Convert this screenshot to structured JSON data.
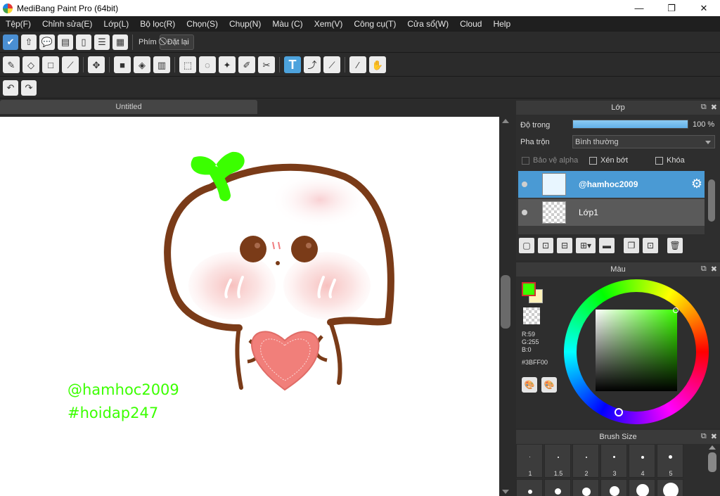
{
  "window": {
    "title": "MediBang Paint Pro (64bit)",
    "minimize_glyph": "—",
    "maximize_glyph": "❐",
    "close_glyph": "✕"
  },
  "menu": [
    "Tệp(F)",
    "Chỉnh sửa(E)",
    "Lớp(L)",
    "Bộ lọc(R)",
    "Chọn(S)",
    "Chụp(N)",
    "Màu (C)",
    "Xem(V)",
    "Công cụ(T)",
    "Cửa sổ(W)",
    "Cloud",
    "Help"
  ],
  "toolbar": {
    "shortcut_label": "Phím",
    "reset_label": "Đặt lại",
    "text_tool_glyph": "T"
  },
  "document": {
    "tab_title": "Untitled",
    "watermark_1": "@hamhoc2009",
    "watermark_2": "#hoidap247"
  },
  "layer_panel": {
    "title": "Lớp",
    "opacity_label": "Độ trong",
    "opacity_value": "100 %",
    "opacity_fraction": 1.0,
    "blend_label": "Pha trộn",
    "blend_value": "Bình thường",
    "protect_alpha": "Bảo vệ alpha",
    "clipping": "Xén bớt",
    "lock": "Khóa",
    "layers": [
      {
        "name": "@hamhoc2009",
        "selected": true
      },
      {
        "name": "Lớp1",
        "selected": false
      }
    ]
  },
  "color_panel": {
    "title": "Màu",
    "r": "R:59",
    "g": "G:255",
    "b": "B:0",
    "hex": "#3BFF00",
    "fg_color": "#3bff00",
    "bg_color": "#fff2b8"
  },
  "brush_panel": {
    "title": "Brush Size",
    "sizes": [
      "1",
      "1.5",
      "2",
      "3",
      "4",
      "5"
    ]
  },
  "colors": {
    "accent": "#4a9ad4",
    "watermark": "#3bff00",
    "stroke_brown": "#7a3b18",
    "sprout": "#3bff00",
    "heart": "#f17f7a"
  }
}
